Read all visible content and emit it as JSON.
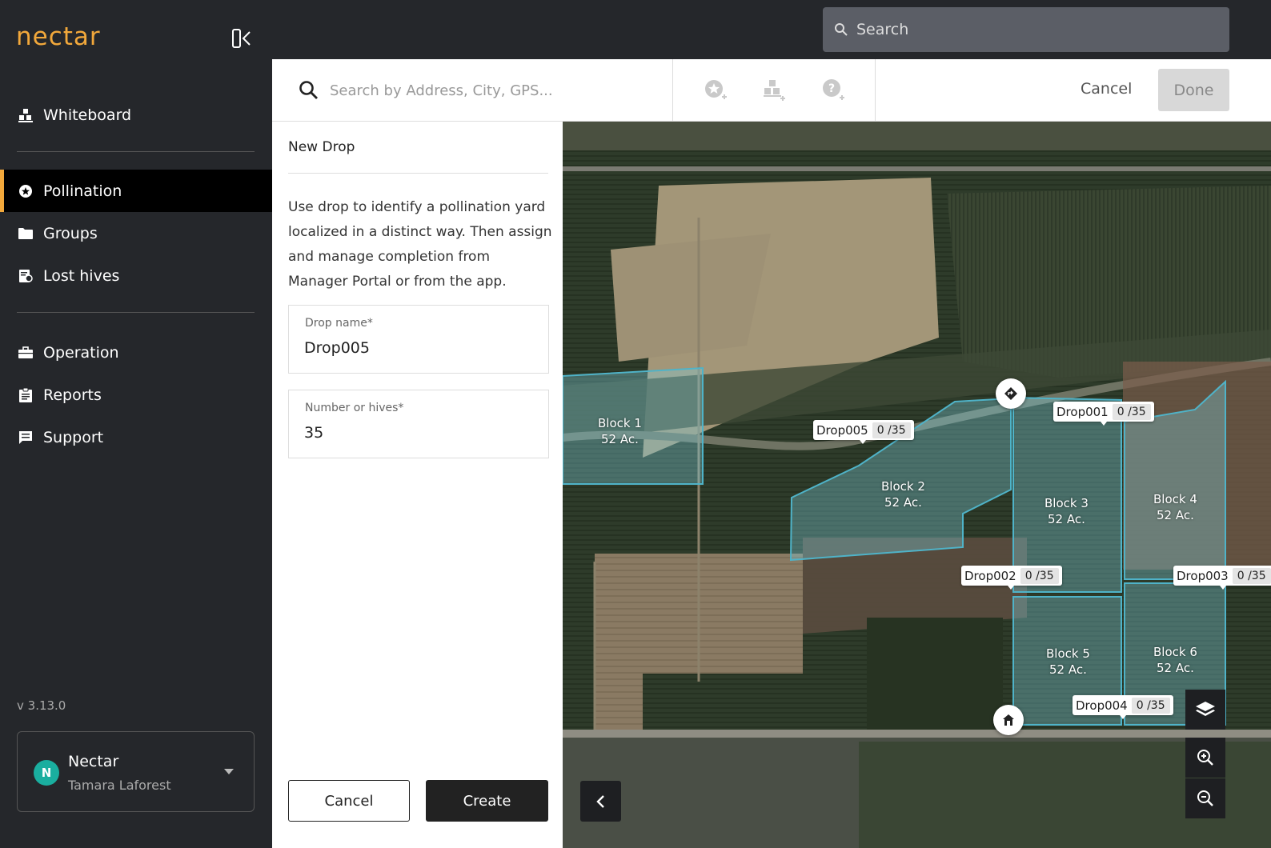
{
  "app": {
    "logo": "nectar",
    "version": "v 3.13.0"
  },
  "sidebar": {
    "items": [
      {
        "label": "Whiteboard",
        "icon": "whiteboard-icon"
      },
      {
        "label": "Pollination",
        "icon": "pollination-icon",
        "active": true
      },
      {
        "label": "Groups",
        "icon": "folder-icon"
      },
      {
        "label": "Lost hives",
        "icon": "lost-hives-icon"
      },
      {
        "label": "Operation",
        "icon": "briefcase-icon"
      },
      {
        "label": "Reports",
        "icon": "clipboard-icon"
      },
      {
        "label": "Support",
        "icon": "chat-icon"
      }
    ],
    "account": {
      "initial": "N",
      "name": "Nectar",
      "user": "Tamara Laforest"
    }
  },
  "topbar": {
    "search_placeholder": "Search"
  },
  "toolbar": {
    "map_search_placeholder": "Search by Address, City, GPS...",
    "tools": [
      "add-drop-icon",
      "add-yard-icon",
      "add-poi-icon"
    ],
    "cancel_label": "Cancel",
    "done_label": "Done"
  },
  "form": {
    "title": "New Drop",
    "description": "Use drop to identify a pollination yard localized in a distinct way. Then assign and manage completion from Manager Portal or from the app.",
    "drop_name_label": "Drop name*",
    "drop_name_value": "Drop005",
    "hives_label": "Number or hives*",
    "hives_value": "35",
    "cancel_label": "Cancel",
    "create_label": "Create"
  },
  "map": {
    "blocks": [
      {
        "name": "Block 1",
        "area": "52 Ac."
      },
      {
        "name": "Block 2",
        "area": "52 Ac."
      },
      {
        "name": "Block 3",
        "area": "52 Ac."
      },
      {
        "name": "Block 4",
        "area": "52 Ac."
      },
      {
        "name": "Block 5",
        "area": "52 Ac."
      },
      {
        "name": "Block 6",
        "area": "52 Ac."
      }
    ],
    "drops": [
      {
        "name": "Drop005",
        "count": "0 /35"
      },
      {
        "name": "Drop001",
        "count": "0 /35"
      },
      {
        "name": "Drop002",
        "count": "0 /35"
      },
      {
        "name": "Drop003",
        "count": "0 /35"
      },
      {
        "name": "Drop004",
        "count": "0 /35"
      }
    ],
    "colors": {
      "accent": "#f2a83b",
      "block_fill": "#7fd1e0",
      "block_stroke": "#4fb3c8"
    }
  }
}
